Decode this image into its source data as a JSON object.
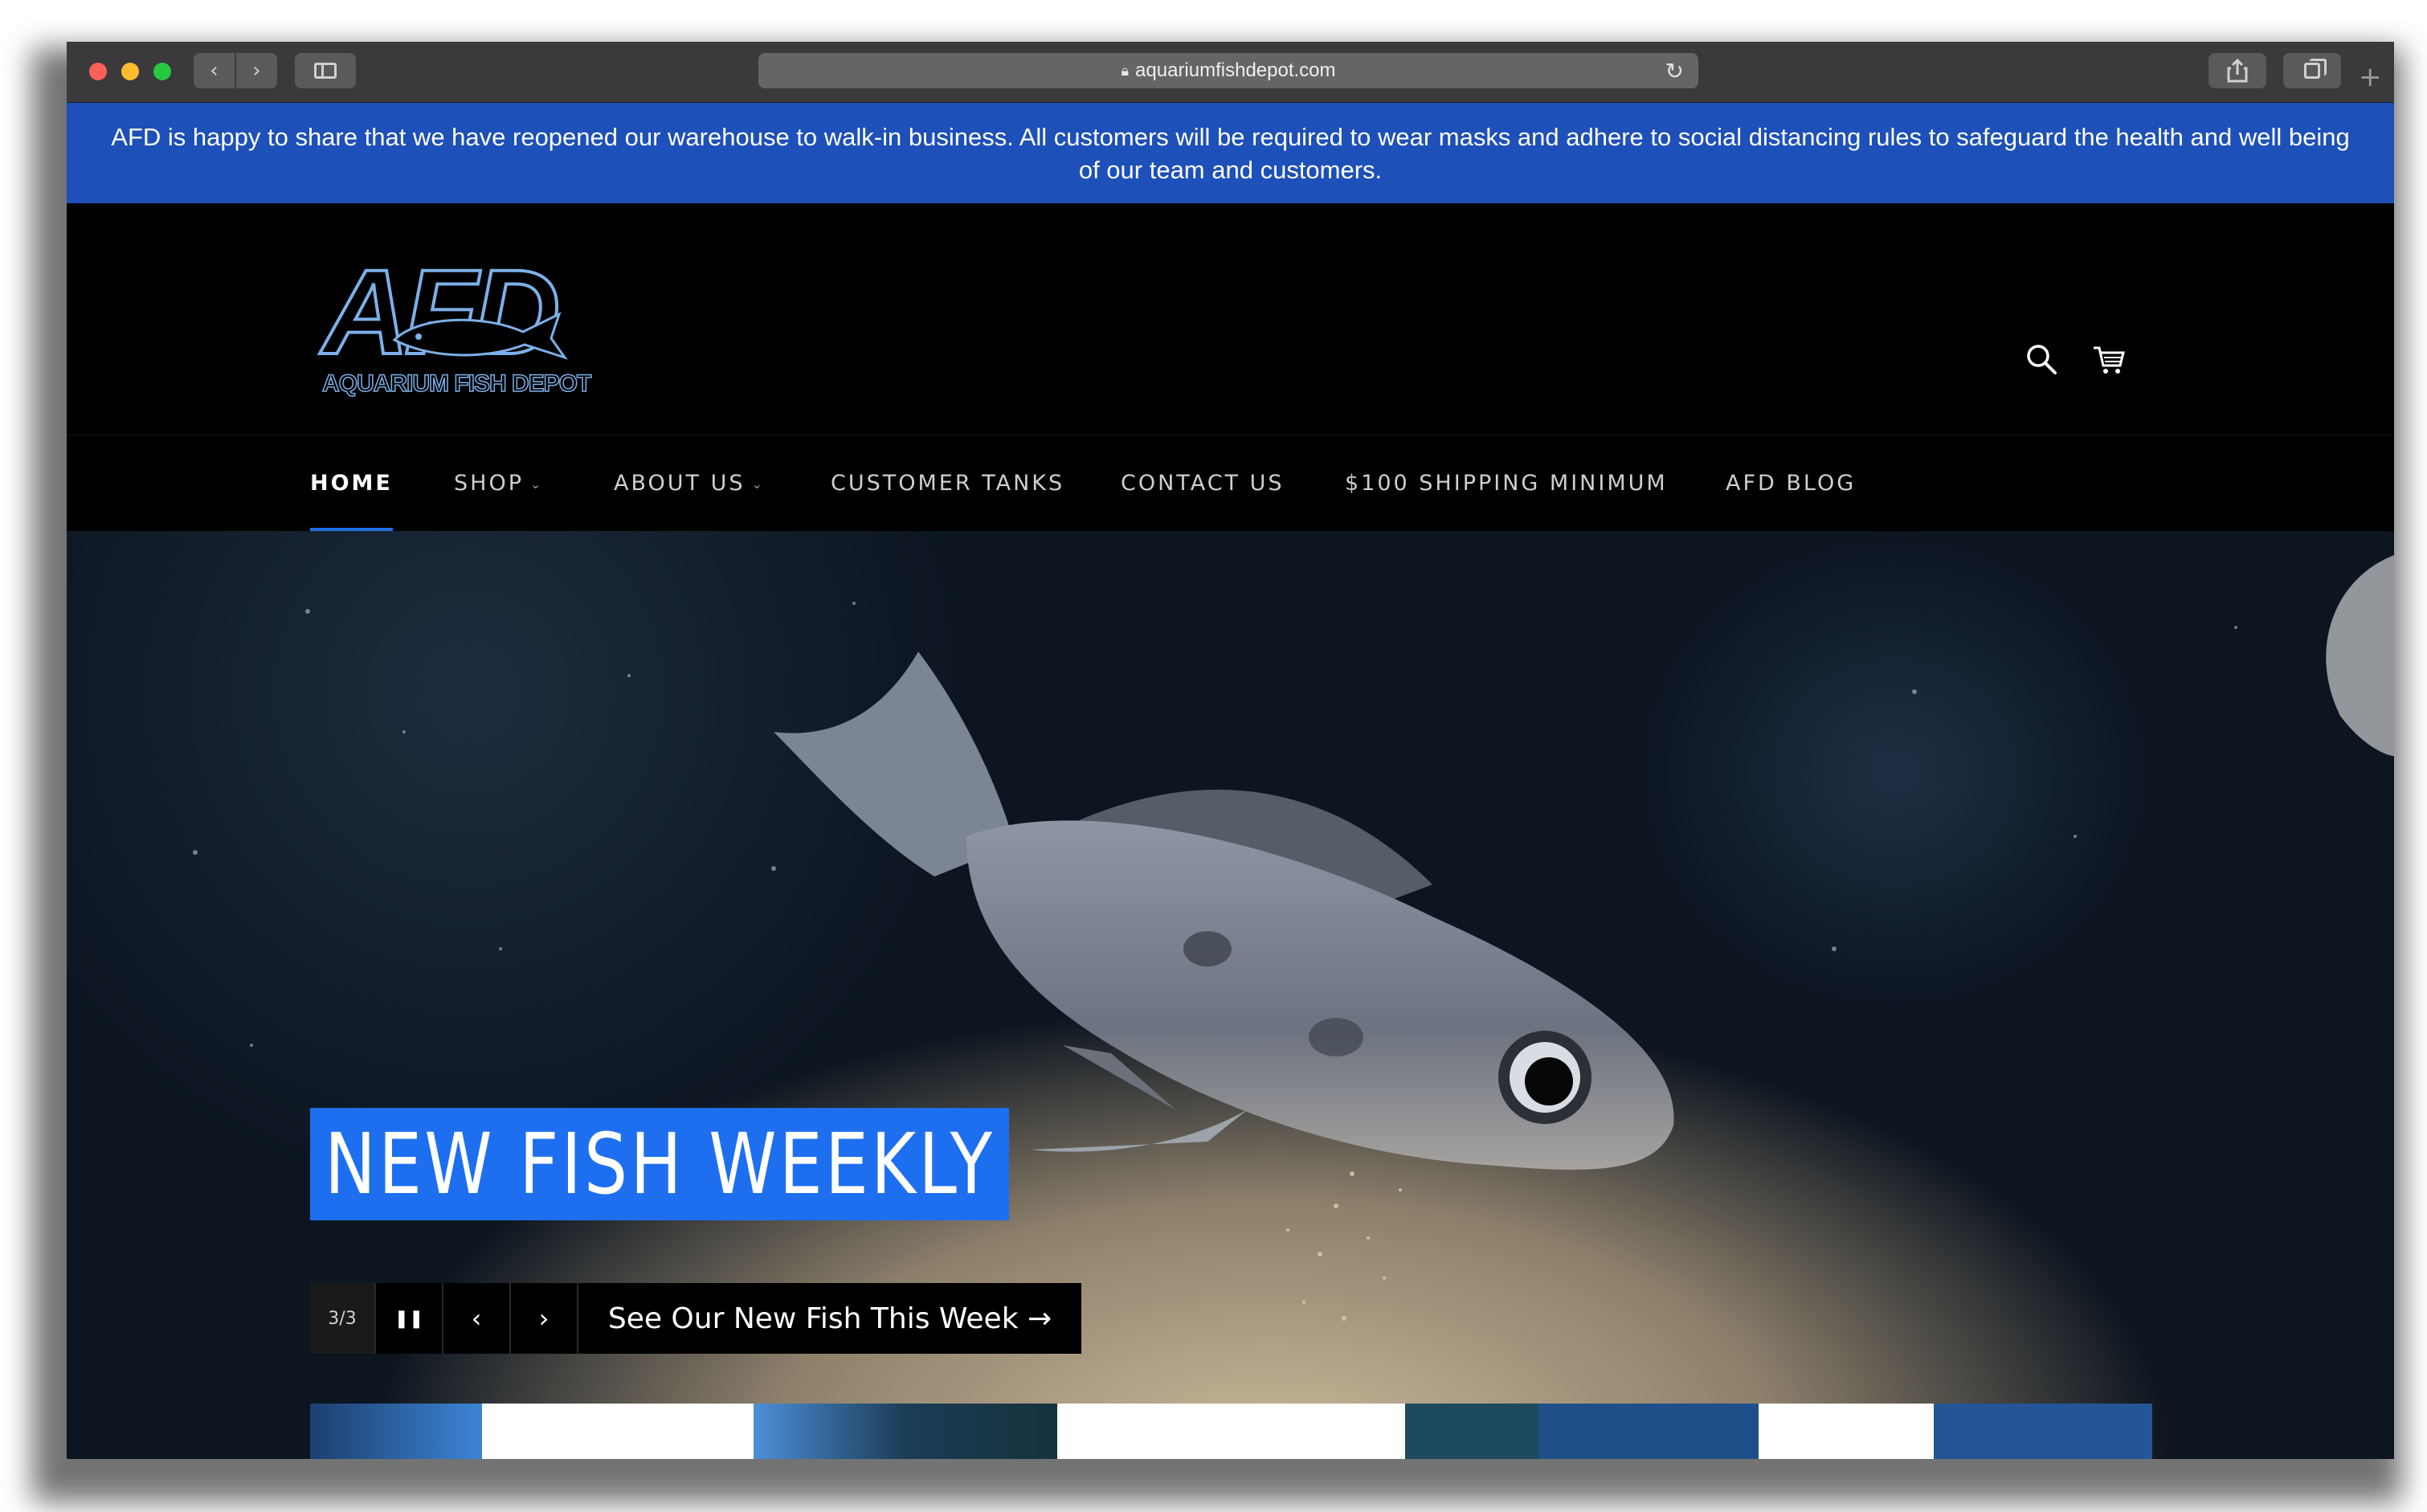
{
  "browser": {
    "url": "aquariumfishdepot.com"
  },
  "announcement": "AFD is happy to share that we have reopened our warehouse to walk-in business. All customers will be required to wear masks and adhere to social distancing rules to safeguard the health and well being of our team and customers.",
  "logo": {
    "letters": "AFD",
    "subtitle": "AQUARIUM FISH DEPOT"
  },
  "nav": [
    {
      "label": "HOME",
      "active": true
    },
    {
      "label": "SHOP",
      "dropdown": true
    },
    {
      "label": "ABOUT US",
      "dropdown": true
    },
    {
      "label": "CUSTOMER TANKS"
    },
    {
      "label": "CONTACT US"
    },
    {
      "label": "$100 SHIPPING MINIMUM"
    },
    {
      "label": "AFD BLOG"
    }
  ],
  "hero": {
    "headline": "NEW FISH WEEKLY",
    "slide_counter": "3/3",
    "pause_icon": "pause-icon",
    "prev_icon": "chevron-left-icon",
    "next_icon": "chevron-right-icon",
    "cta": "See Our New Fish This Week →"
  },
  "colors": {
    "announcement_bg": "#1d50b8",
    "accent": "#1d6ff0",
    "header_bg": "#000000"
  }
}
